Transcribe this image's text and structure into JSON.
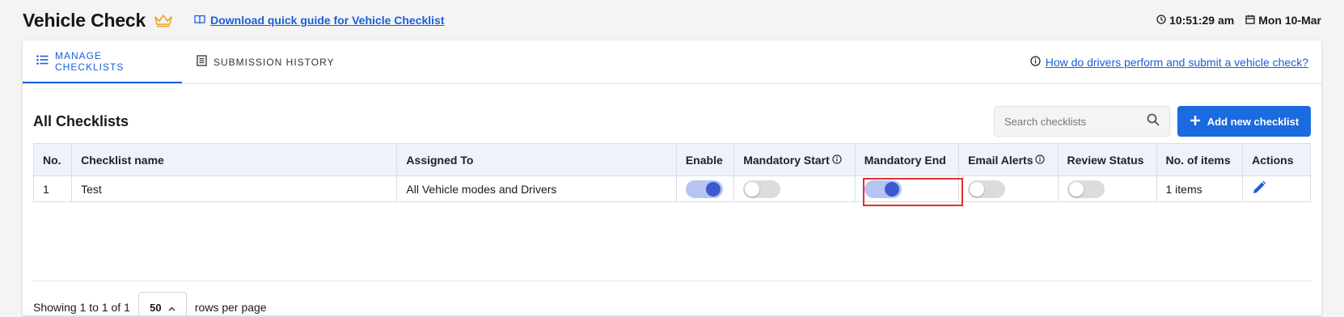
{
  "header": {
    "title": "Vehicle Check",
    "guide_link": "Download quick guide for Vehicle Checklist",
    "time": "10:51:29 am",
    "date": "Mon 10-Mar"
  },
  "tabs": [
    {
      "label": "MANAGE CHECKLISTS",
      "active": true
    },
    {
      "label": "SUBMISSION HISTORY",
      "active": false
    }
  ],
  "help_link": "How do drivers perform and submit a vehicle check?",
  "section": {
    "title": "All Checklists",
    "search_placeholder": "Search checklists",
    "add_button": "Add new checklist"
  },
  "table": {
    "columns": [
      "No.",
      "Checklist name",
      "Assigned To",
      "Enable",
      "Mandatory Start",
      "Mandatory End",
      "Email Alerts",
      "Review Status",
      "No. of items",
      "Actions"
    ],
    "rows": [
      {
        "no": "1",
        "name": "Test",
        "assigned_to": "All Vehicle modes and Drivers",
        "enable": true,
        "mandatory_start": false,
        "mandatory_end": true,
        "email_alerts": false,
        "review_status": false,
        "items": "1 items"
      }
    ]
  },
  "footer": {
    "showing": "Showing 1 to 1 of 1",
    "rows_per_page_value": "50",
    "rows_per_page_label": "rows per page"
  },
  "colors": {
    "accent": "#1a6ae0",
    "link": "#1a5fd6",
    "toggle_on_track": "#b7c3f2",
    "toggle_on_knob": "#3c59d2",
    "highlight": "#e03131",
    "crown": "#f0a020"
  }
}
